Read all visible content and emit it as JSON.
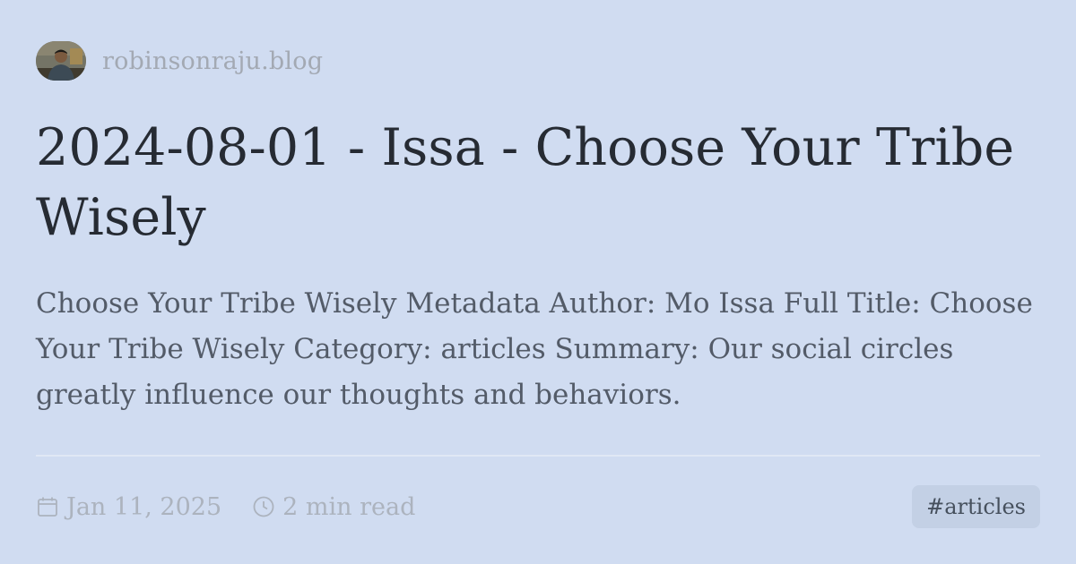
{
  "site": {
    "name": "robinsonraju.blog",
    "avatar_icon": "author-avatar"
  },
  "post": {
    "title": "2024-08-01 - Issa - Choose Your Tribe Wisely",
    "summary": "Choose Your Tribe Wisely Metadata Author: Mo Issa Full Title: Choose Your Tribe Wisely Category: articles Summary: Our social circles greatly influence our thoughts and behaviors.",
    "date": "Jan 11, 2025",
    "date_icon": "calendar-icon",
    "read_time": "2 min read",
    "read_time_icon": "clock-icon",
    "tag": "#articles"
  },
  "colors": {
    "background": "#d0dcf1",
    "title": "#262b33",
    "summary": "#535b68",
    "muted": "#acb3be",
    "tag_background": "#c3d0e5"
  }
}
